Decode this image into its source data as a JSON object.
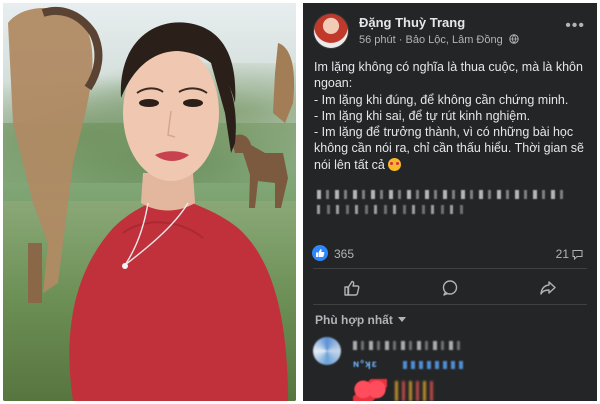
{
  "photo": {
    "description_alt": "selfie"
  },
  "post": {
    "author": "Đặng Thuỳ Trang",
    "time": "56 phút",
    "location": "Bảo Lộc, Lâm Đồng",
    "more_label": "•••",
    "text_lines": [
      "Im lặng không có nghĩa là thua cuộc, mà là khôn ngoan:",
      "- Im lặng khi đúng, để không cần chứng minh.",
      "- Im lặng khi sai, để tự rút kinh nghiệm.",
      "- Im lặng để trưởng thành, vì có những bài học không cần nói ra, chỉ cần thấu hiểu. Thời gian sẽ nói lên tất cả"
    ],
    "reaction_count": "365",
    "comment_count": "21",
    "sort_label": "Phù hợp nhất",
    "comment_snippet": "ɴ°ʞɛ",
    "colors": {
      "background": "#242526",
      "text": "#e4e6eb",
      "muted": "#b0b3b8",
      "like_blue": "#2d88ff"
    }
  }
}
